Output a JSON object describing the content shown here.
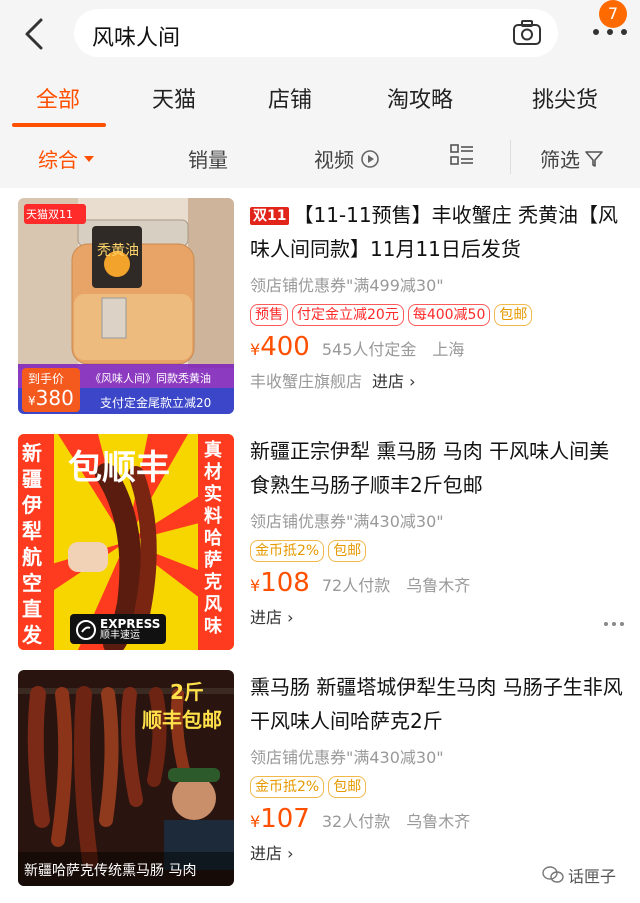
{
  "header": {
    "search_query": "风味人间",
    "notification_count": "7"
  },
  "tabs": [
    "全部",
    "天猫",
    "店铺",
    "淘攻略",
    "挑尖货"
  ],
  "sortbar": {
    "comprehensive": "综合",
    "sales": "销量",
    "video": "视频",
    "filter": "筛选"
  },
  "items": [
    {
      "badge": "双11",
      "title": "【11-11预售】丰收蟹庄 秃黄油【风味人间同款】11月11日后发货",
      "coupon": "领店铺优惠券\"满499减30\"",
      "tags": [
        "预售",
        "付定金立减20元",
        "每400减50",
        "包邮"
      ],
      "price": "400",
      "sales": "545人付定金",
      "location": "上海",
      "shop": "丰收蟹庄旗舰店",
      "enter": "进店",
      "thumb": {
        "corner": "天猫双11",
        "jar_label": "秃黄油",
        "caption": "《风味人间》同款秃黄油",
        "deposit_label": "到手价",
        "deposit_price": "380",
        "bottom_note": "支付定金尾款立减20"
      }
    },
    {
      "title": "新疆正宗伊犁 熏马肠 马肉 干风味人间美食熟生马肠子顺丰2斤包邮",
      "coupon": "领店铺优惠券\"满430减30\"",
      "tags": [
        "金币抵2%",
        "包邮"
      ],
      "price": "108",
      "sales": "72人付款",
      "location": "乌鲁木齐",
      "enter": "进店",
      "thumb": {
        "headline": "包顺丰",
        "left_text": "新疆伊犁航空直发",
        "right_text": "真材实料哈萨克风味",
        "express": "EXPRESS",
        "express_cn": "顺丰速运"
      }
    },
    {
      "title": "熏马肠 新疆塔城伊犁生马肉 马肠子生非风干风味人间哈萨克2斤",
      "coupon": "领店铺优惠券\"满430减30\"",
      "tags": [
        "金币抵2%",
        "包邮"
      ],
      "price": "107",
      "sales": "32人付款",
      "location": "乌鲁木齐",
      "enter": "进店",
      "thumb": {
        "top_line1": "2斤",
        "top_line2": "顺丰包邮",
        "caption": "新疆哈萨克传统熏马肠 马肉"
      }
    }
  ],
  "currency": "¥",
  "watermark": "话匣子",
  "colors": {
    "accent": "#ff5000",
    "double11": "#e1251b"
  }
}
